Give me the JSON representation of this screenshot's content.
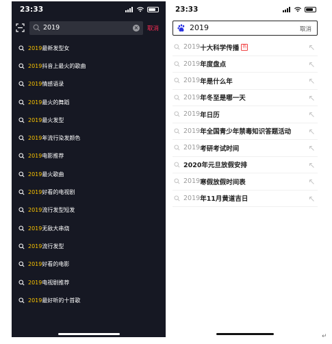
{
  "left": {
    "status": {
      "time": "23:33"
    },
    "search": {
      "query": "2019",
      "cancel": "取消"
    },
    "suggestions": [
      {
        "highlight": "2019",
        "rest": "最新发型女"
      },
      {
        "highlight": "2019",
        "rest": "抖音上最火的歌曲"
      },
      {
        "highlight": "2019",
        "rest": "情感语录"
      },
      {
        "highlight": "2019",
        "rest": "最火的舞蹈"
      },
      {
        "highlight": "2019",
        "rest": "最火发型"
      },
      {
        "highlight": "2019",
        "rest": "年流行染发颜色"
      },
      {
        "highlight": "2019",
        "rest": "电影推荐"
      },
      {
        "highlight": "2019",
        "rest": "最火歌曲"
      },
      {
        "highlight": "2019",
        "rest": "好看的电视剧"
      },
      {
        "highlight": "2019",
        "rest": "流行发型短发"
      },
      {
        "highlight": "2019",
        "rest": "无敌大串烧"
      },
      {
        "highlight": "2019",
        "rest": "流行发型"
      },
      {
        "highlight": "2019",
        "rest": "好看的电影"
      },
      {
        "highlight": "2019",
        "rest": "电视剧推荐"
      },
      {
        "highlight": "2019",
        "rest": "最好听的十首歌"
      }
    ],
    "colors": {
      "background": "#161823",
      "highlight": "#fcc500",
      "cancel": "#fe2c55"
    }
  },
  "right": {
    "status": {
      "time": "23:33"
    },
    "search": {
      "query": "2019",
      "cancel": "取消"
    },
    "suggestions": [
      {
        "prefix": "2019",
        "rest": "十大科学传播",
        "badge": "热"
      },
      {
        "prefix": "2019",
        "rest": "年度盘点"
      },
      {
        "prefix": "2019",
        "rest": "年是什么年"
      },
      {
        "prefix": "2019",
        "rest": "年冬至是哪一天"
      },
      {
        "prefix": "2019",
        "rest": "年日历"
      },
      {
        "prefix": "2019",
        "rest": "年全国青少年禁毒知识答题活动"
      },
      {
        "prefix": "2019",
        "rest": "考研考试时间"
      },
      {
        "full": "2020年元旦放假安排"
      },
      {
        "prefix": "2019",
        "rest": "寒假放假时间表"
      },
      {
        "prefix": "2019",
        "rest": "年11月黄道吉日"
      }
    ],
    "colors": {
      "brand": "#2932e1",
      "badge": "#f04142"
    }
  },
  "return_symbol": "↵"
}
